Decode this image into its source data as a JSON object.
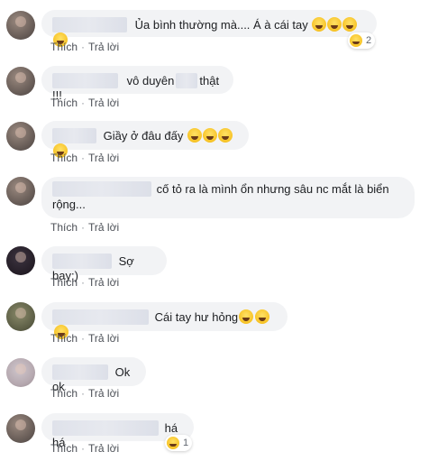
{
  "actions": {
    "like": "Thích",
    "reply": "Trả lời"
  },
  "comments": [
    {
      "text": "Ủa bình thường mà.... Á à cái tay",
      "reaction_count": "2"
    },
    {
      "text_a": "vô duyên",
      "text_b": "thật !!!"
    },
    {
      "text": "Giầy ở đâu đấy"
    },
    {
      "text": "cố tỏ ra là mình ổn nhưng sâu nc mắt là biển rộng..."
    },
    {
      "text": "Sợ bay:)"
    },
    {
      "text": "Cái tay hư hỏng"
    },
    {
      "text": "Ok ok"
    },
    {
      "text": "há há",
      "reaction_count": "1"
    }
  ],
  "colors": {
    "bubble": "#f2f3f5",
    "action_text": "#4b4f56"
  }
}
